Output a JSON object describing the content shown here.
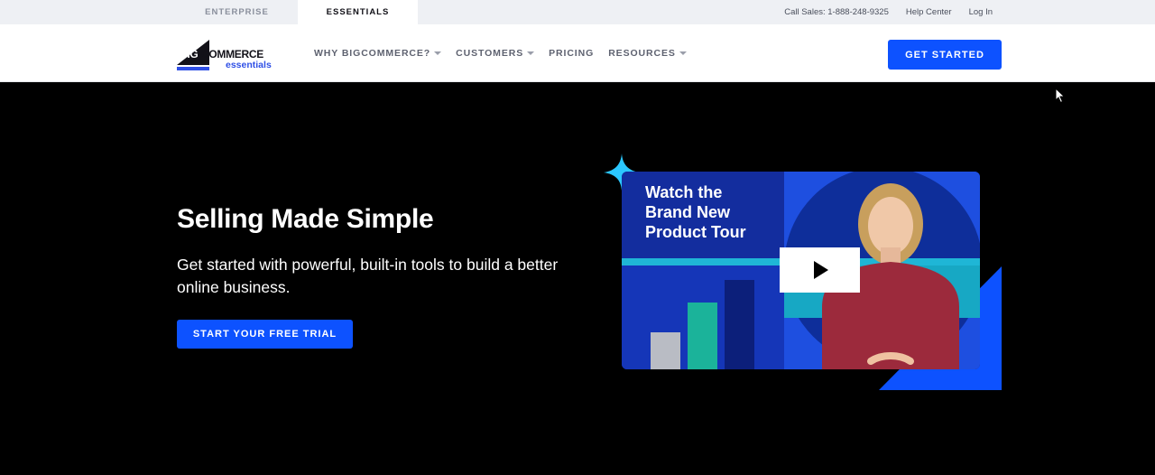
{
  "utility": {
    "tabs": [
      "ENTERPRISE",
      "ESSENTIALS"
    ],
    "links": [
      "Call Sales: 1-888-248-9325",
      "Help Center",
      "Log In"
    ]
  },
  "logo": {
    "big": "BIG",
    "commerce": "COMMERCE",
    "sub": "essentials"
  },
  "nav": {
    "items": [
      "WHY BIGCOMMERCE?",
      "CUSTOMERS",
      "PRICING",
      "RESOURCES"
    ],
    "cta": "GET STARTED"
  },
  "hero": {
    "title": "Selling Made Simple",
    "subtitle": "Get started with powerful, built-in tools to build a better online business.",
    "cta": "START YOUR FREE TRIAL"
  },
  "video": {
    "title_lines": [
      "Watch the",
      "Brand New",
      "Product Tour"
    ]
  },
  "colors": {
    "accent": "#0d52ff",
    "hero_bg": "#000000",
    "utility_bg": "#eef0f4",
    "sparkle": "#2bc7ff"
  }
}
